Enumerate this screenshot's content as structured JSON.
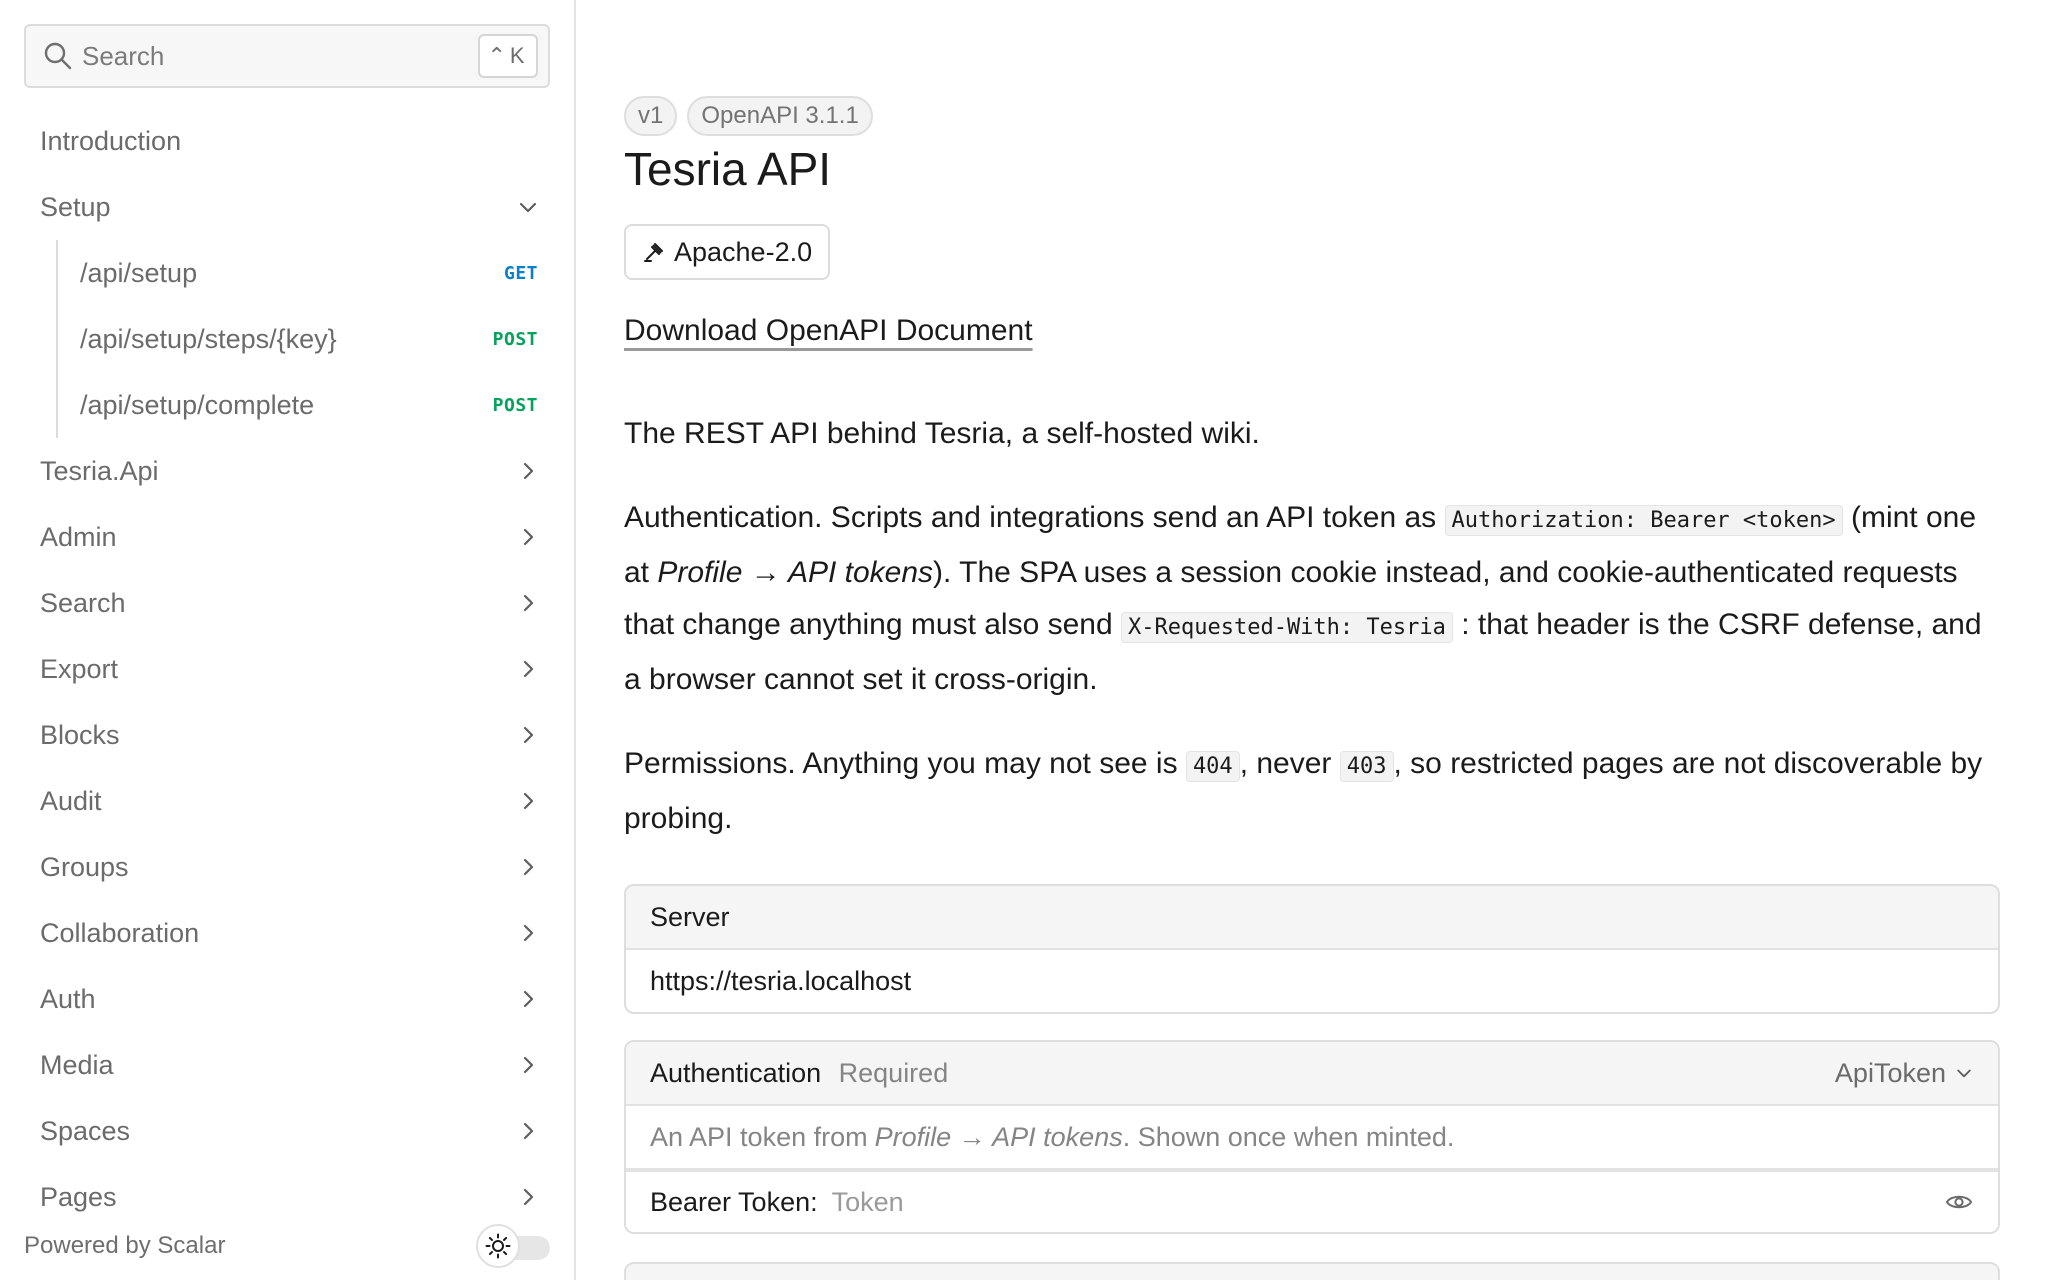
{
  "sidebar": {
    "search": {
      "placeholder": "Search",
      "shortcut": "⌃K"
    },
    "intro_label": "Introduction",
    "setup": {
      "label": "Setup",
      "items": [
        {
          "path": "/api/setup",
          "method": "GET"
        },
        {
          "path": "/api/setup/steps/{key}",
          "method": "POST"
        },
        {
          "path": "/api/setup/complete",
          "method": "POST"
        }
      ]
    },
    "groups": [
      {
        "label": "Tesria.Api"
      },
      {
        "label": "Admin"
      },
      {
        "label": "Search"
      },
      {
        "label": "Export"
      },
      {
        "label": "Blocks"
      },
      {
        "label": "Audit"
      },
      {
        "label": "Groups"
      },
      {
        "label": "Collaboration"
      },
      {
        "label": "Auth"
      },
      {
        "label": "Media"
      },
      {
        "label": "Spaces"
      },
      {
        "label": "Pages"
      }
    ],
    "footer": {
      "powered_by": "Powered by Scalar"
    }
  },
  "main": {
    "badges": {
      "version": "v1",
      "openapi": "OpenAPI 3.1.1"
    },
    "title": "Tesria API",
    "license": "Apache-2.0",
    "download_label": "Download OpenAPI Document",
    "description": {
      "intro": "The REST API behind Tesria, a self-hosted wiki.",
      "auth_1": "Authentication. Scripts and integrations send an API token as ",
      "auth_code_1": "Authorization: Bearer <token>",
      "auth_2": " (mint one at ",
      "auth_em": "Profile → API tokens",
      "auth_3": "). The SPA uses a session cookie instead, and cookie-authenticated requests that change anything must also send ",
      "auth_code_2": "X-Requested-With: Tesria",
      "auth_4": " : that header is the CSRF defense, and a browser cannot set it cross-origin.",
      "perm_1": "Permissions. Anything you may not see is ",
      "perm_code_1": "404",
      "perm_2": ", never ",
      "perm_code_2": "403",
      "perm_3": ", so restricted pages are not discoverable by probing."
    },
    "server": {
      "label": "Server",
      "url": "https://tesria.localhost"
    },
    "authentication": {
      "label": "Authentication",
      "required": "Required",
      "scheme": "ApiToken",
      "help_1": "An API token from ",
      "help_em": "Profile → API tokens",
      "help_2": ". Shown once when minted.",
      "bearer_label": "Bearer Token:",
      "bearer_placeholder": "Token"
    }
  },
  "colors": {
    "get": "#0a7fd0",
    "post": "#06a15a",
    "border": "#dedede",
    "muted_text": "#6b6b6b"
  }
}
